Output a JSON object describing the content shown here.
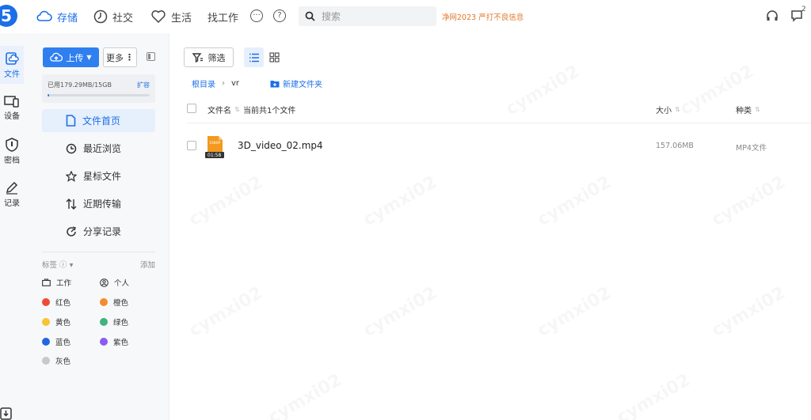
{
  "app": {
    "logo_text": "5"
  },
  "nav": {
    "storage": "存储",
    "social": "社交",
    "life": "生活",
    "jobs": "找工作"
  },
  "search": {
    "placeholder": "搜索"
  },
  "notice": "净网2023 严打不良信息",
  "notification_count": "2",
  "rail": [
    {
      "label": "文件",
      "icon": "file-cloud-icon"
    },
    {
      "label": "设备",
      "icon": "devices-icon"
    },
    {
      "label": "密档",
      "icon": "shield-icon"
    },
    {
      "label": "记录",
      "icon": "pen-icon"
    }
  ],
  "sidebar": {
    "upload_label": "上传",
    "more_label": "更多",
    "storage_text": "已用179.29MB/15GB",
    "storage_expand": "扩容",
    "storage_used_fraction": 0.012,
    "menu": [
      {
        "label": "文件首页",
        "icon": "file-icon"
      },
      {
        "label": "最近浏览",
        "icon": "history-icon"
      },
      {
        "label": "星标文件",
        "icon": "star-icon"
      },
      {
        "label": "近期传输",
        "icon": "transfer-icon"
      },
      {
        "label": "分享记录",
        "icon": "share-icon"
      }
    ],
    "tags_title": "标签",
    "tags_add": "添加",
    "tags": [
      {
        "label": "工作",
        "icon": "briefcase-icon"
      },
      {
        "label": "个人",
        "icon": "person-icon"
      },
      {
        "label": "红色",
        "color": "#f04b3a"
      },
      {
        "label": "橙色",
        "color": "#f58b2e"
      },
      {
        "label": "黄色",
        "color": "#f7c531"
      },
      {
        "label": "绿色",
        "color": "#3fb27f"
      },
      {
        "label": "蓝色",
        "color": "#2266e0"
      },
      {
        "label": "紫色",
        "color": "#8a5cf0"
      },
      {
        "label": "灰色",
        "color": "#c8c8c8"
      }
    ]
  },
  "main": {
    "filter_label": "筛选",
    "breadcrumb": {
      "root": "根目录",
      "current": "vr"
    },
    "new_folder": "新建文件夹",
    "columns": {
      "name": "文件名",
      "count": "当前共1个文件",
      "size": "大小",
      "type": "种类"
    },
    "files": [
      {
        "name": "3D_video_02.mp4",
        "size": "157.06MB",
        "type": "MP4文件",
        "duration": "01:58",
        "badge": "1080P"
      }
    ]
  },
  "colors": {
    "accent": "#1d6fe8",
    "notice": "#e0772a"
  }
}
